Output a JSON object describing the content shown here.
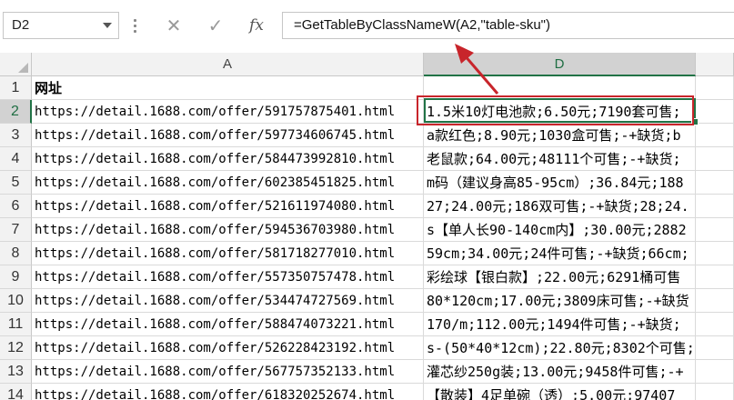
{
  "name_box": {
    "value": "D2"
  },
  "formula_bar": {
    "cancel_glyph": "✕",
    "enter_glyph": "✓",
    "fx_label": "fx",
    "formula": "=GetTableByClassNameW(A2,\"table-sku\")"
  },
  "columns": [
    {
      "label": "A",
      "selected": false
    },
    {
      "label": "D",
      "selected": true
    }
  ],
  "rows": [
    {
      "num": "1",
      "a": "网址",
      "d": ""
    },
    {
      "num": "2",
      "a": "https://detail.1688.com/offer/591757875401.html",
      "d": "1.5米10灯电池款;6.50元;7190套可售;"
    },
    {
      "num": "3",
      "a": "https://detail.1688.com/offer/597734606745.html",
      "d": "a款红色;8.90元;1030盒可售;-+缺货;b"
    },
    {
      "num": "4",
      "a": "https://detail.1688.com/offer/584473992810.html",
      "d": "老鼠款;64.00元;48111个可售;-+缺货;"
    },
    {
      "num": "5",
      "a": "https://detail.1688.com/offer/602385451825.html",
      "d": "m码（建议身高85-95cm）;36.84元;188"
    },
    {
      "num": "6",
      "a": "https://detail.1688.com/offer/521611974080.html",
      "d": "27;24.00元;186双可售;-+缺货;28;24."
    },
    {
      "num": "7",
      "a": "https://detail.1688.com/offer/594536703980.html",
      "d": "s【单人长90-140cm内】;30.00元;2882"
    },
    {
      "num": "8",
      "a": "https://detail.1688.com/offer/581718277010.html",
      "d": "59cm;34.00元;24件可售;-+缺货;66cm;"
    },
    {
      "num": "9",
      "a": "https://detail.1688.com/offer/557350757478.html",
      "d": "彩绘球【银白款】;22.00元;6291桶可售"
    },
    {
      "num": "10",
      "a": "https://detail.1688.com/offer/534474727569.html",
      "d": "80*120cm;17.00元;3809床可售;-+缺货"
    },
    {
      "num": "11",
      "a": "https://detail.1688.com/offer/588474073221.html",
      "d": "170/m;112.00元;1494件可售;-+缺货;"
    },
    {
      "num": "12",
      "a": "https://detail.1688.com/offer/526228423192.html",
      "d": "s-(50*40*12cm);22.80元;8302个可售;"
    },
    {
      "num": "13",
      "a": "https://detail.1688.com/offer/567757352133.html",
      "d": "灌芯纱250g装;13.00元;9458件可售;-+"
    },
    {
      "num": "14",
      "a": "https://detail.1688.com/offer/618320252674.html",
      "d": "【散装】4足单碗（透）;5.00元;97407"
    }
  ],
  "colors": {
    "selection": "#217346",
    "annotation": "#c8252b",
    "header_bg": "#f2f2f2",
    "header_selected_bg": "#d2d2d2",
    "gridline": "#dadada"
  },
  "annotation": {
    "type": "arrow-and-box",
    "points_to": "formula",
    "highlights": "D2"
  }
}
